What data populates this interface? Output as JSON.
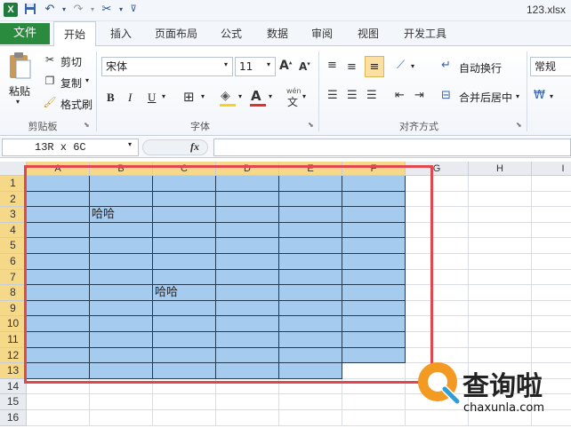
{
  "window": {
    "title": "123.xlsx"
  },
  "tabs": [
    {
      "label": "文件"
    },
    {
      "label": "开始"
    },
    {
      "label": "插入"
    },
    {
      "label": "页面布局"
    },
    {
      "label": "公式"
    },
    {
      "label": "数据"
    },
    {
      "label": "审阅"
    },
    {
      "label": "视图"
    },
    {
      "label": "开发工具"
    }
  ],
  "clipboard": {
    "paste": "粘贴",
    "cut": "剪切",
    "copy": "复制",
    "format_painter": "格式刷",
    "group": "剪贴板"
  },
  "font": {
    "family": "宋体",
    "size": "11",
    "bold": "B",
    "italic": "I",
    "underline": "U",
    "group": "字体",
    "phonetic": "wén"
  },
  "alignment": {
    "wrap": "自动换行",
    "merge": "合并后居中",
    "group": "对齐方式"
  },
  "number": {
    "format": "常规"
  },
  "formula_bar": {
    "name_box": "13R x 6C",
    "fx": "fx",
    "value": ""
  },
  "columns": [
    "A",
    "B",
    "C",
    "D",
    "E",
    "F",
    "G",
    "H",
    "I"
  ],
  "rows": [
    "1",
    "2",
    "3",
    "4",
    "5",
    "6",
    "7",
    "8",
    "9",
    "10",
    "11",
    "12",
    "13",
    "14",
    "15",
    "16"
  ],
  "cells": {
    "B3": "哈哈",
    "C8": "哈哈"
  },
  "selection": {
    "range": "A1:F13",
    "fill_color": "#a5ccee",
    "highlight_color": "#e2474f"
  },
  "watermark": {
    "text": "查询啦",
    "url": "chaxunla.com"
  }
}
